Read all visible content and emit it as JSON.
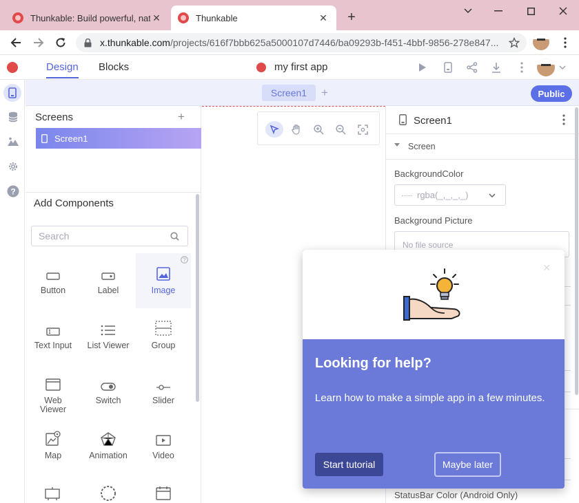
{
  "browser": {
    "tabs": [
      {
        "title": "Thunkable: Build powerful, native",
        "active": false
      },
      {
        "title": "Thunkable",
        "active": true
      }
    ],
    "url_host": "x.thunkable.com",
    "url_path": "/projects/616f7bbb625a5000107d7446/ba09293b-f451-4bbf-9856-278e847..."
  },
  "header": {
    "tabs": [
      "Design",
      "Blocks"
    ],
    "active_tab": "Design",
    "app_title": "my first app"
  },
  "screenbar": {
    "screen_tab": "Screen1",
    "public_label": "Public"
  },
  "screens_panel": {
    "title": "Screens",
    "items": [
      "Screen1"
    ]
  },
  "components_panel": {
    "title": "Add Components",
    "search_placeholder": "Search",
    "items": [
      {
        "label": "Button",
        "icon": "button-icon"
      },
      {
        "label": "Label",
        "icon": "label-icon"
      },
      {
        "label": "Image",
        "icon": "image-icon",
        "selected": true
      },
      {
        "label": "Text Input",
        "icon": "text-input-icon"
      },
      {
        "label": "List Viewer",
        "icon": "list-icon"
      },
      {
        "label": "Group",
        "icon": "group-icon"
      },
      {
        "label": "Web Viewer",
        "icon": "web-viewer-icon"
      },
      {
        "label": "Switch",
        "icon": "switch-icon"
      },
      {
        "label": "Slider",
        "icon": "slider-icon"
      },
      {
        "label": "Map",
        "icon": "map-icon"
      },
      {
        "label": "Animation",
        "icon": "animation-icon"
      },
      {
        "label": "Video",
        "icon": "video-icon"
      }
    ]
  },
  "properties": {
    "component_name": "Screen1",
    "section": "Screen",
    "background_color_label": "BackgroundColor",
    "background_color_value": "rgba(_,_,_,_)",
    "background_picture_label": "Background Picture",
    "background_picture_value": "No file source",
    "statusbar_label": "StatusBar Color (Android Only)"
  },
  "help_popup": {
    "title": "Looking for help?",
    "body": "Learn how to make a simple app in a few minutes.",
    "start_label": "Start tutorial",
    "later_label": "Maybe later"
  },
  "colors": {
    "accent": "#5566dd",
    "popup_bg": "#6b7ad8",
    "tabstrip": "#e8c4cf"
  }
}
